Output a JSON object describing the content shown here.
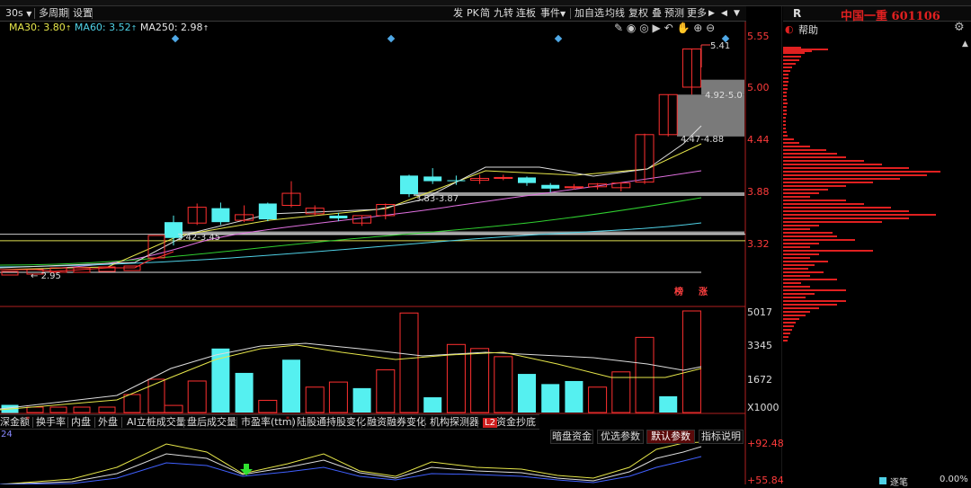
{
  "toolbar": {
    "period": "30s",
    "items": [
      "多周期",
      "设置"
    ],
    "right_items": [
      "发",
      "PK",
      "简",
      "九转",
      "连板",
      "事件",
      "加自选",
      "均线",
      "复权",
      "叠",
      "预测",
      "更多"
    ]
  },
  "ma_legend": {
    "ma5": "",
    "ma30": "MA30: 3.80",
    "ma60": "MA60: 3.52",
    "ma250": "MA250: 2.98"
  },
  "price_axis": [
    "5.55",
    "5.00",
    "4.44",
    "3.88",
    "3.32"
  ],
  "volume_axis": [
    "5017",
    "3345",
    "1672",
    "X1000"
  ],
  "indicator_axis": [
    "+92.48",
    "+55.84"
  ],
  "indicator_num": "24",
  "annotations": {
    "high": "5.41",
    "gap_top": "4.92-5.0",
    "gap_mid": "4.47-4.88",
    "zone1": "3.83-3.87",
    "zone2": "3.42-3.45",
    "low": "2.95",
    "tag1": "榜",
    "tag2": "涨"
  },
  "sidebar": {
    "r": "R",
    "stock_title": "中国一重 601106",
    "help": "帮助",
    "status": "逐笔",
    "pct": "0.00%"
  },
  "lower_tabs": [
    "深金额",
    "换手率",
    "内盘",
    "外盘",
    "AI立桩成交量",
    "盘后成交量",
    "市盈率(ttm)",
    "陆股通持股变化",
    "融资融券变化",
    "机构探测器",
    "资金抄底"
  ],
  "l2": "L2",
  "indicator_buttons": [
    "暗盘资金",
    "优选参数",
    "默认参数",
    "指标说明"
  ],
  "candles": [
    {
      "o": 3.55,
      "c": 3.38,
      "h": 3.62,
      "l": 3.3
    },
    {
      "o": 3.54,
      "c": 3.71,
      "h": 3.75,
      "l": 3.52
    },
    {
      "o": 3.7,
      "c": 3.55,
      "h": 3.76,
      "l": 3.52
    },
    {
      "o": 3.57,
      "c": 3.63,
      "h": 3.73,
      "l": 3.55
    },
    {
      "o": 3.75,
      "c": 3.58,
      "h": 3.76,
      "l": 3.56
    },
    {
      "o": 3.73,
      "c": 3.86,
      "h": 3.99,
      "l": 3.71
    },
    {
      "o": 3.64,
      "c": 3.7,
      "h": 3.73,
      "l": 3.62
    },
    {
      "o": 3.62,
      "c": 3.59,
      "h": 3.65,
      "l": 3.56
    },
    {
      "o": 3.54,
      "c": 3.62,
      "h": 3.62,
      "l": 3.51
    },
    {
      "o": 3.62,
      "c": 3.74,
      "h": 3.75,
      "l": 3.58
    },
    {
      "o": 4.05,
      "c": 3.85,
      "h": 4.06,
      "l": 3.82
    },
    {
      "o": 4.04,
      "c": 3.99,
      "h": 4.13,
      "l": 3.96
    },
    {
      "o": 4.0,
      "c": 3.99,
      "h": 4.05,
      "l": 3.95
    },
    {
      "o": 4.0,
      "c": 4.02,
      "h": 4.06,
      "l": 3.96
    },
    {
      "o": 4.02,
      "c": 4.03,
      "h": 4.06,
      "l": 4.0
    },
    {
      "o": 4.03,
      "c": 3.97,
      "h": 4.04,
      "l": 3.94
    },
    {
      "o": 3.95,
      "c": 3.91,
      "h": 3.97,
      "l": 3.87
    },
    {
      "o": 3.93,
      "c": 3.93,
      "h": 3.96,
      "l": 3.9
    },
    {
      "o": 3.93,
      "c": 3.96,
      "h": 3.97,
      "l": 3.9
    },
    {
      "o": 3.92,
      "c": 3.97,
      "h": 3.98,
      "l": 3.88
    },
    {
      "o": 3.98,
      "c": 4.49,
      "h": 4.5,
      "l": 3.96
    },
    {
      "o": 4.49,
      "c": 4.92,
      "h": 4.92,
      "l": 4.47
    },
    {
      "o": 5.0,
      "c": 5.41,
      "h": 5.41,
      "l": 4.92
    }
  ],
  "volumes": [
    0.35,
    1.55,
    3.15,
    1.95,
    0.6,
    2.6,
    1.25,
    1.5,
    1.2,
    2.1,
    4.9,
    0.75,
    3.35,
    3.15,
    2.75,
    1.9,
    1.4,
    1.55,
    1.25,
    2.0,
    3.7,
    0.8,
    5.0
  ],
  "vol_up": [
    true,
    true,
    false,
    false,
    true,
    false,
    true,
    true,
    false,
    true,
    true,
    false,
    true,
    true,
    true,
    false,
    false,
    false,
    true,
    true,
    true,
    false,
    true
  ]
}
